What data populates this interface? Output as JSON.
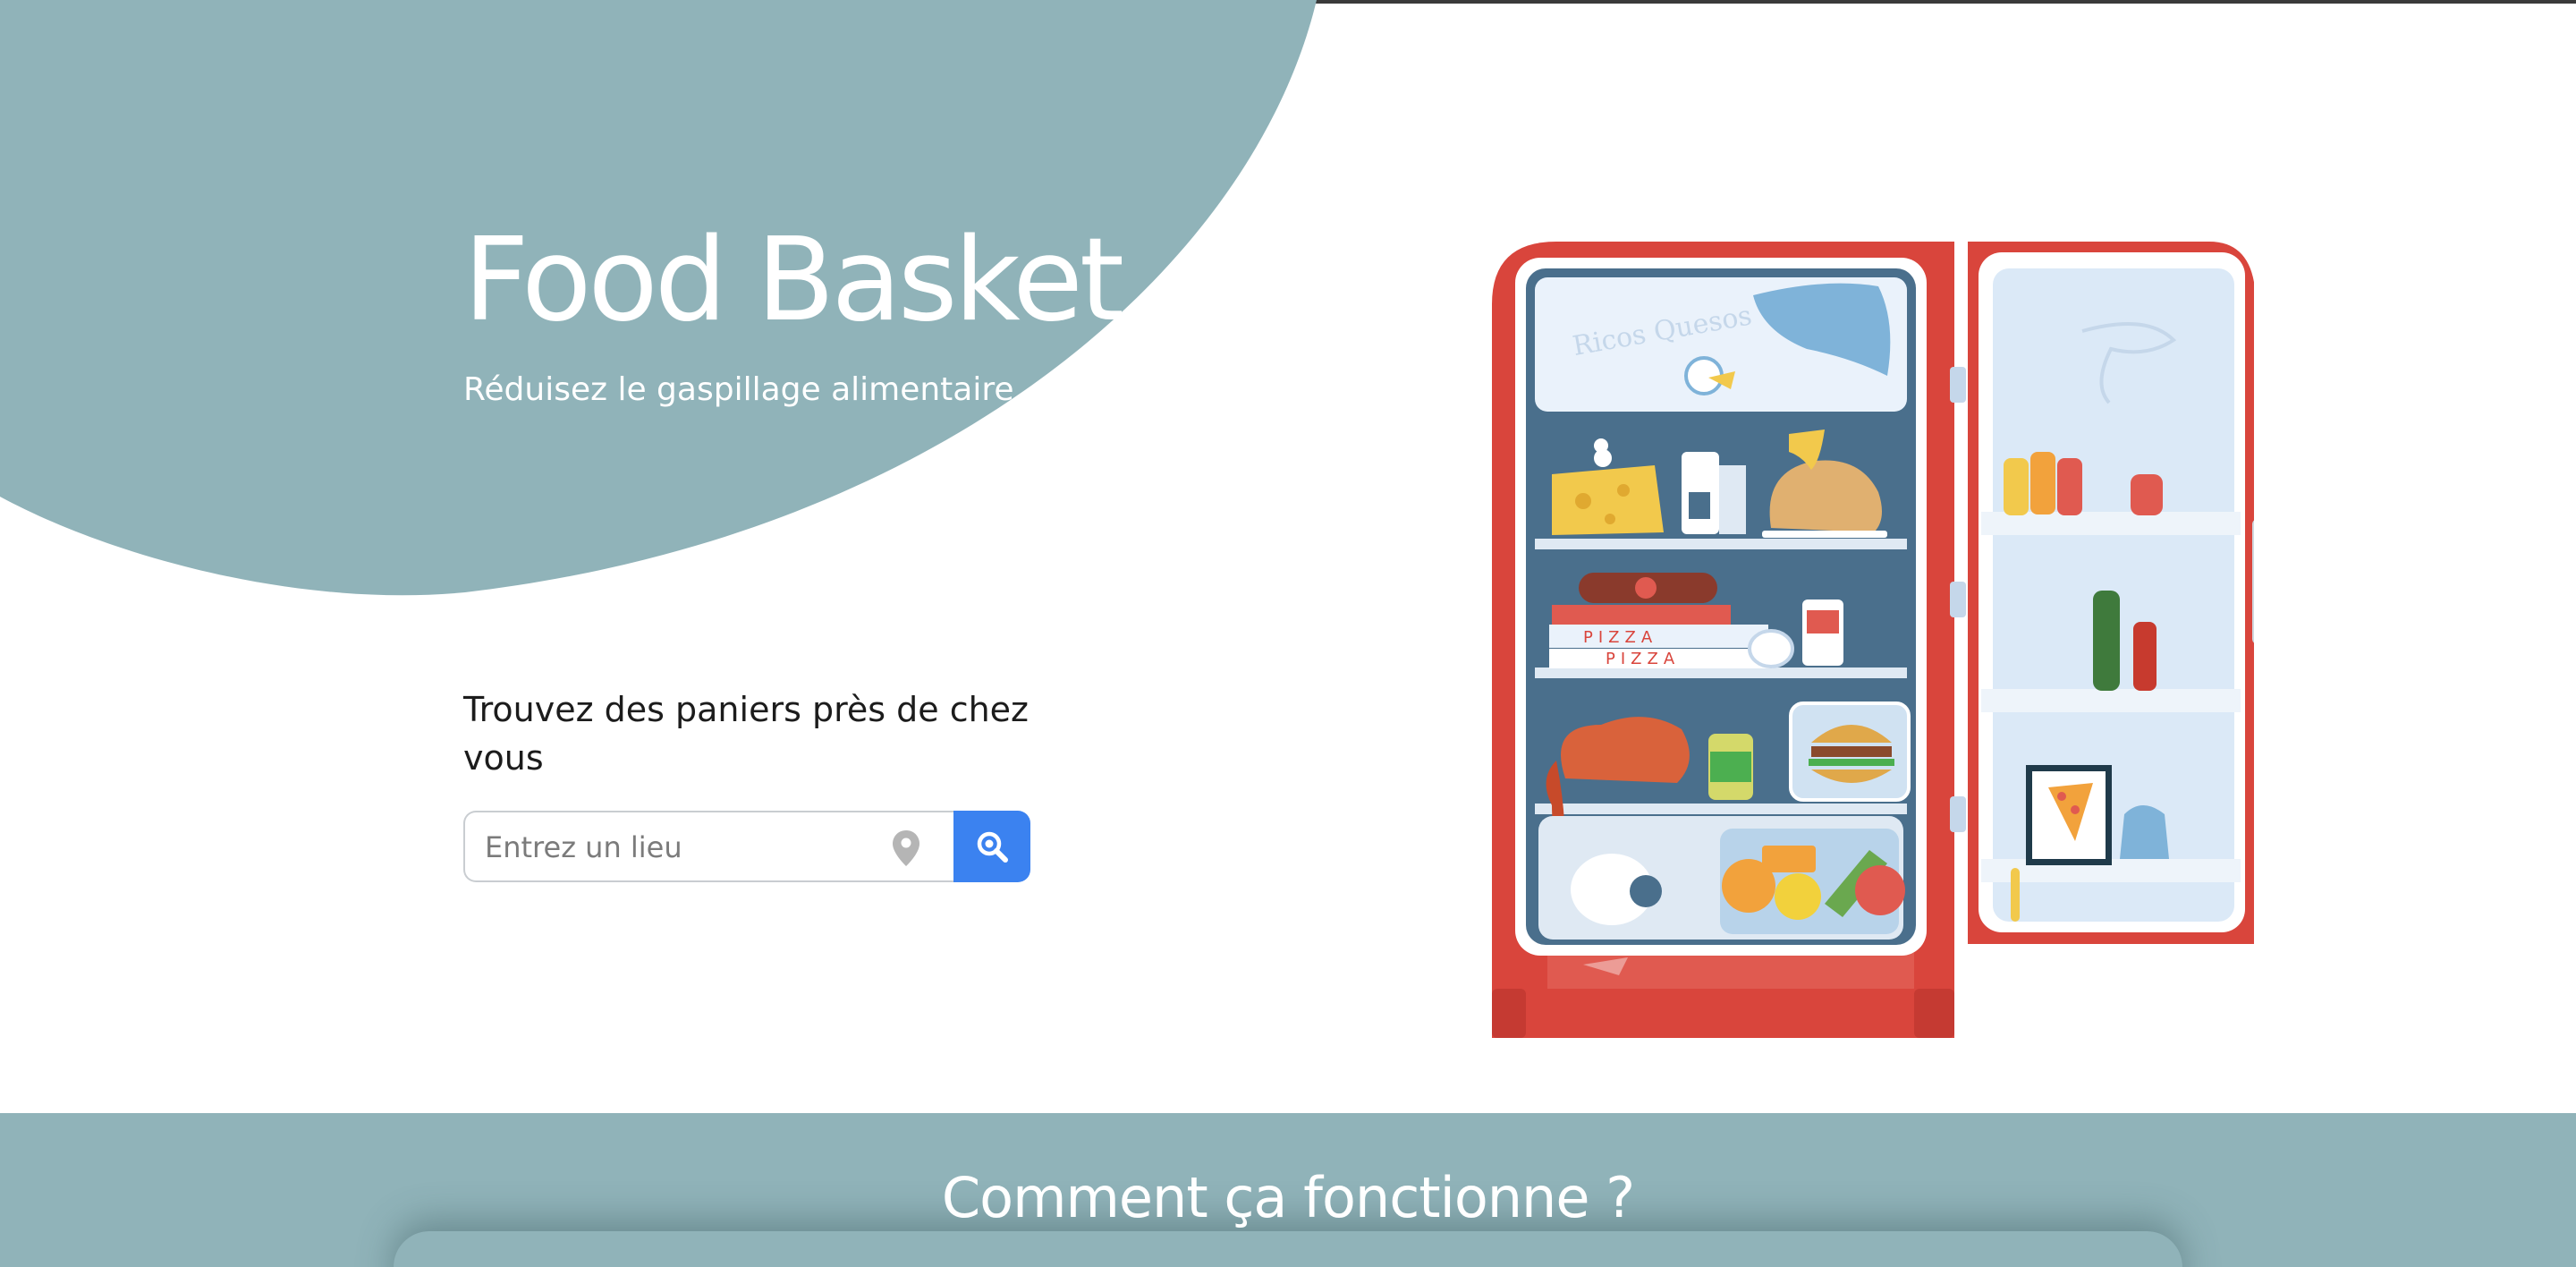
{
  "hero": {
    "title": "Food Basket",
    "subtitle": "Réduisez le gaspillage alimentaire"
  },
  "search": {
    "heading": "Trouvez des paniers près de chez vous",
    "placeholder": "Entrez un lieu",
    "location_icon": "map-pin-icon",
    "button_icon": "search-icon"
  },
  "illustration": {
    "pizza_box_label": "PIZZA",
    "label_text": "Ricos Quesos"
  },
  "footer": {
    "title": "Comment ça fonctionne ?"
  },
  "colors": {
    "accent_teal": "#90b3b9",
    "search_button_blue": "#3b82f0",
    "fridge_red": "#d9453c"
  }
}
